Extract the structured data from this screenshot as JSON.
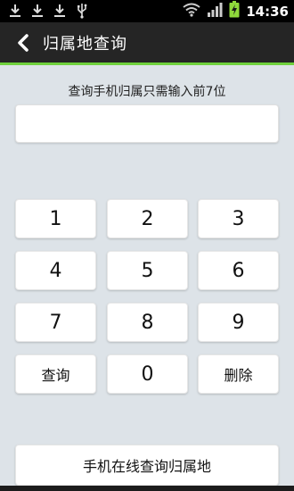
{
  "status_bar": {
    "time": "14:36",
    "left_icons": [
      "download-icon",
      "download-icon",
      "download-icon",
      "usb-icon"
    ],
    "right_icons": [
      "wifi-icon",
      "signal-icon",
      "battery-charging-icon"
    ]
  },
  "action_bar": {
    "title": "归属地查询",
    "back_icon": "back-icon",
    "accent_color": "#6fd13c"
  },
  "hint": "查询手机归属只需输入前7位",
  "phone_input": {
    "value": "",
    "placeholder": ""
  },
  "keypad": {
    "k1": "1",
    "k2": "2",
    "k3": "3",
    "k4": "4",
    "k5": "5",
    "k6": "6",
    "k7": "7",
    "k8": "8",
    "k9": "9",
    "query": "查询",
    "k0": "0",
    "delete": "删除"
  },
  "online_button": "手机在线查询归属地"
}
